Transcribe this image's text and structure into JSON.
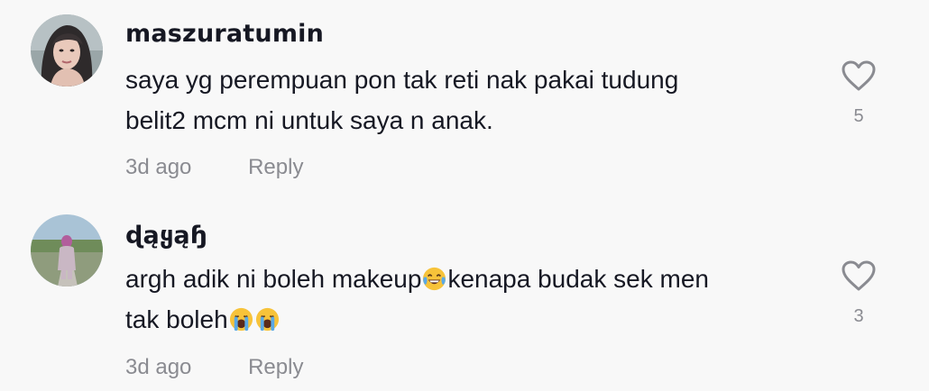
{
  "comments": [
    {
      "username": "maszuratumin",
      "text_lines": [
        "saya yg perempuan pon tak reti nak pakai tudung",
        "belit2 mcm ni untuk saya n anak."
      ],
      "date": "3d ago",
      "reply_label": "Reply",
      "like_count": "5"
    },
    {
      "username": "ɖąყąɧ",
      "text_line1_a": "argh adik ni boleh makeup",
      "text_line1_b": "kenapa budak sek men",
      "text_line2": "tak boleh",
      "emojis": [
        "face-with-tears-of-joy-icon",
        "loudly-crying-face-icon",
        "loudly-crying-face-icon"
      ],
      "date": "3d ago",
      "reply_label": "Reply",
      "like_count": "3"
    }
  ],
  "colors": {
    "background": "#f8f8f8",
    "text": "#161823",
    "secondary": "#8a8b91"
  }
}
